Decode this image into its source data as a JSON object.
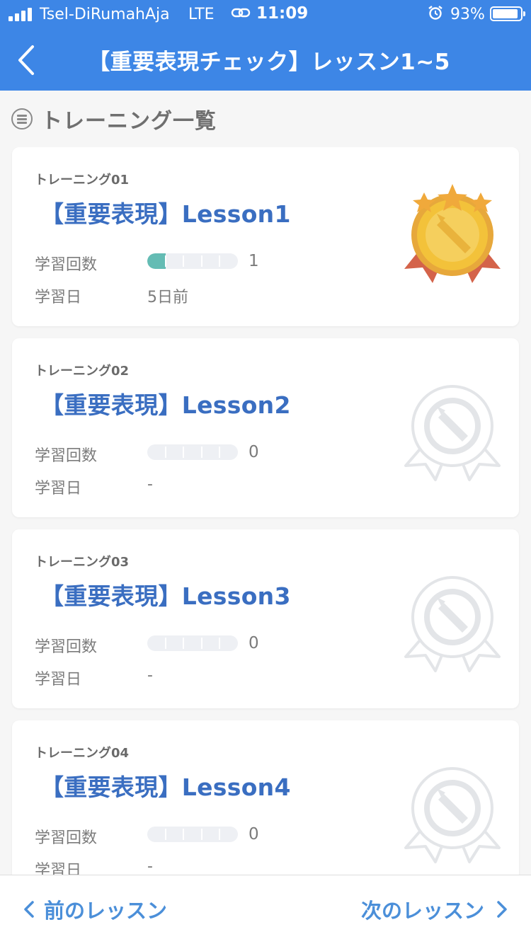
{
  "status_bar": {
    "carrier": "Tsel-DiRumahAja",
    "network": "LTE",
    "time": "11:09",
    "battery": "93%",
    "battery_level": 0.93
  },
  "header": {
    "title": "【重要表現チェック】レッスン1~5",
    "back_icon": "chevron-left-icon"
  },
  "section": {
    "icon": "list-icon",
    "title": "トレーニング一覧"
  },
  "colors": {
    "header_bg": "#3d86e6",
    "title_blue": "#3a6ec1",
    "progress_fill": "#64bcb4",
    "medal_gold": "#f3c23a"
  },
  "cards": [
    {
      "label": "トレーニング01",
      "title": "【重要表現】Lesson1",
      "count_label": "学習回数",
      "count": "1",
      "progress_segments_filled": 1,
      "progress_segments_total": 5,
      "date_label": "学習日",
      "date": "5日前",
      "medal": "gold-medal-icon"
    },
    {
      "label": "トレーニング02",
      "title": "【重要表現】Lesson2",
      "count_label": "学習回数",
      "count": "0",
      "progress_segments_filled": 0,
      "progress_segments_total": 5,
      "date_label": "学習日",
      "date": "-",
      "medal": "locked-medal-icon"
    },
    {
      "label": "トレーニング03",
      "title": "【重要表現】Lesson3",
      "count_label": "学習回数",
      "count": "0",
      "progress_segments_filled": 0,
      "progress_segments_total": 5,
      "date_label": "学習日",
      "date": "-",
      "medal": "locked-medal-icon"
    },
    {
      "label": "トレーニング04",
      "title": "【重要表現】Lesson4",
      "count_label": "学習回数",
      "count": "0",
      "progress_segments_filled": 0,
      "progress_segments_total": 5,
      "date_label": "学習日",
      "date": "-",
      "medal": "locked-medal-icon"
    }
  ],
  "footer": {
    "prev_label": "前のレッスン",
    "next_label": "次のレッスン"
  }
}
